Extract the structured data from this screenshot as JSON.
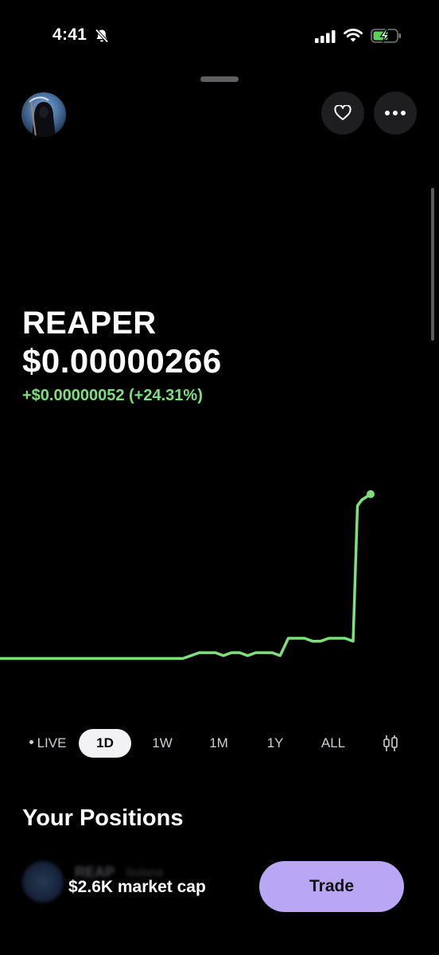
{
  "status_bar": {
    "time": "4:41"
  },
  "token": {
    "name": "REAPER",
    "price": "$0.00000266",
    "change": "+$0.00000052 (+24.31%)"
  },
  "colors": {
    "accent_green": "#7ee07a",
    "trade_purple": "#b9a6f5"
  },
  "chart_data": {
    "type": "line",
    "series": [
      {
        "values": [
          2.14,
          2.14,
          2.14,
          2.14,
          2.14,
          2.14,
          2.14,
          2.14,
          2.14,
          2.14,
          2.14,
          2.14,
          2.15,
          2.16,
          2.16,
          2.16,
          2.15,
          2.16,
          2.16,
          2.15,
          2.16,
          2.16,
          2.16,
          2.15,
          2.21,
          2.21,
          2.21,
          2.2,
          2.2,
          2.21,
          2.21,
          2.21,
          2.2,
          2.67,
          2.69,
          2.7,
          2.71
        ]
      }
    ]
  },
  "ranges": [
    {
      "label": "LIVE",
      "active": false
    },
    {
      "label": "1D",
      "active": true
    },
    {
      "label": "1W",
      "active": false
    },
    {
      "label": "1M",
      "active": false
    },
    {
      "label": "1Y",
      "active": false
    },
    {
      "label": "ALL",
      "active": false
    }
  ],
  "positions": {
    "title": "Your Positions",
    "blurred_ticker": "REAP",
    "blurred_chain": "Solana"
  },
  "footer": {
    "market_cap": "$2.6K market cap",
    "trade_label": "Trade"
  }
}
